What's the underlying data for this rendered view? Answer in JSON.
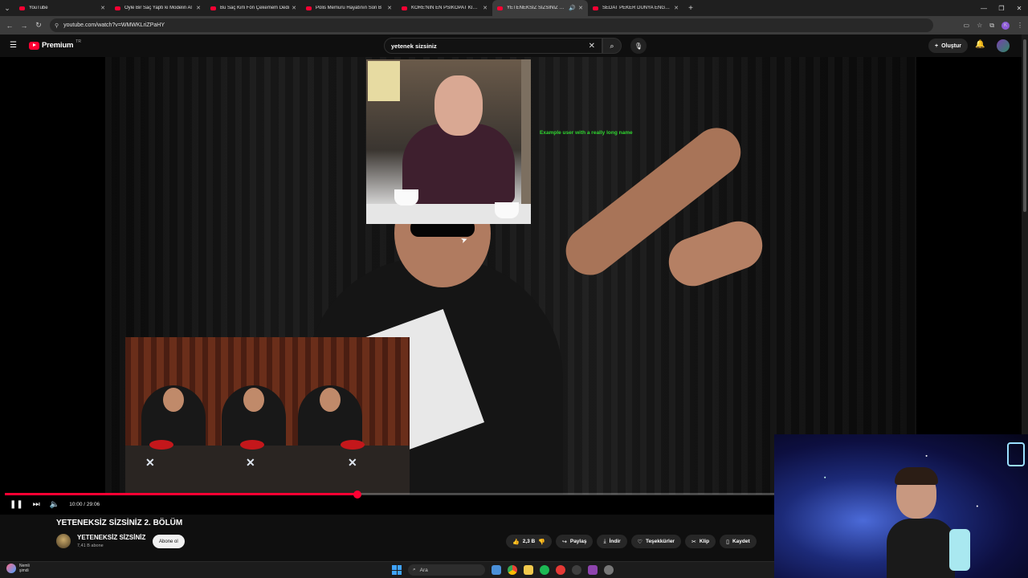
{
  "browser": {
    "tabs": [
      {
        "title": "YouTube",
        "active": false
      },
      {
        "title": "Öyle Bir Saç Yaptı ki Modelin Al",
        "active": false
      },
      {
        "title": "Bu Saç Kirli Fön Çekemem Dedi",
        "active": false
      },
      {
        "title": "Polis Memuru Hayatının Son B",
        "active": false
      },
      {
        "title": "KORE'NİN EN PSİKOPAT KIZI - Y",
        "active": false
      },
      {
        "title": "YETENEKSİZ SİZSİNİZ 2. BÖ",
        "active": true
      },
      {
        "title": "SEDAT PEKER DÜNYA ENGELLİ",
        "active": false
      }
    ],
    "new_tab": "+",
    "url": "youtube.com/watch?v=WMWKLriZPaHY"
  },
  "youtube": {
    "brand": "Premium",
    "region": "TR",
    "search_value": "yetenek sizsiniz",
    "create_label": "Oluştur",
    "accent": "#ff0033"
  },
  "overlay": {
    "username": "Example user with a really long name"
  },
  "player": {
    "time": "10:00 / 29:06",
    "progress": 0.458
  },
  "video": {
    "title": "YETENEKSİZ SİZSİNİZ 2. BÖLÜM",
    "channel": "YETENEKSİZ SİZSİNİZ",
    "subscribers": "7,41 B abone",
    "subscribe_label": "Abone ol",
    "likes": "2,3 B",
    "share": "Paylaş",
    "download": "İndir",
    "thanks": "Teşekkürler",
    "clip": "Klip",
    "save": "Kaydet"
  },
  "taskbar": {
    "weather_line1": "Nemli",
    "weather_line2": "şimdi",
    "search_placeholder": "Ara"
  }
}
